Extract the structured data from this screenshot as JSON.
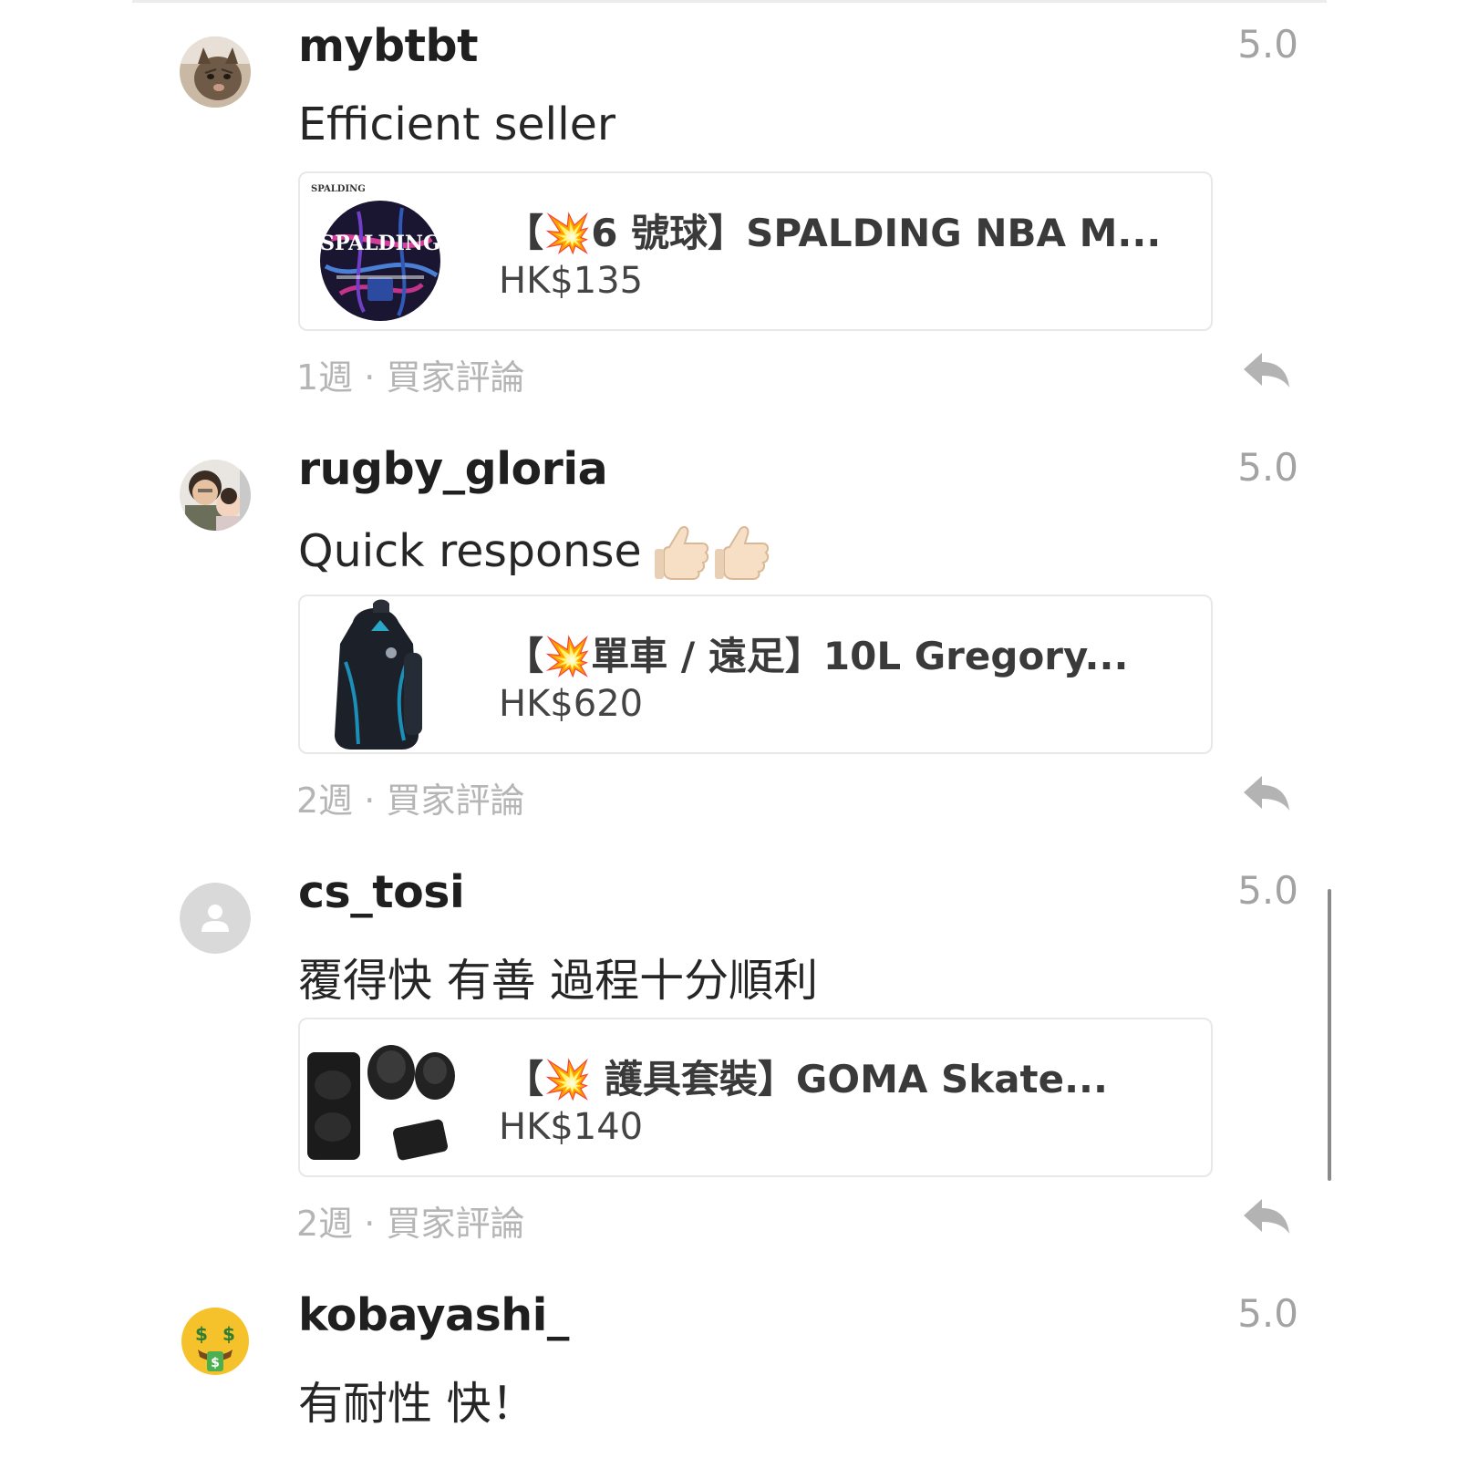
{
  "reviews": [
    {
      "username": "mybtbt",
      "rating": "5.0",
      "comment": "Efficient seller",
      "product_title": "【💥6 號球】SPALDING NBA M...",
      "product_price": "HK$135",
      "time": "1週",
      "separator": "·",
      "review_type": "買家評論",
      "avatar_icon": "cat-photo-avatar",
      "product_icon": "spalding-basketball-image",
      "product_image_text": "SPALDING",
      "product_image_brand_small": "SPALDING"
    },
    {
      "username": "rugby_gloria",
      "rating": "5.0",
      "comment": "Quick response",
      "comment_emoji": "👍🏻👍🏻",
      "product_title": "【💥單車 / 遠足】10L Gregory...",
      "product_price": "HK$620",
      "time": "2週",
      "separator": "·",
      "review_type": "買家評論",
      "avatar_icon": "person-photo-avatar",
      "product_icon": "backpack-image"
    },
    {
      "username": "cs_tosi",
      "rating": "5.0",
      "comment": "覆得快 有善 過程十分順利",
      "product_title": "【💥 護具套裝】GOMA Skate...",
      "product_price": "HK$140",
      "time": "2週",
      "separator": "·",
      "review_type": "買家評論",
      "avatar_icon": "default-user-avatar",
      "product_icon": "protective-gear-image"
    },
    {
      "username": "kobayashi_",
      "rating": "5.0",
      "comment": "有耐性 快！",
      "avatar_icon": "money-mouth-face-emoji-avatar"
    }
  ],
  "colors": {
    "username": "#1f1f1f",
    "rating": "#a3a3a3",
    "meta": "#b5b5b5",
    "card_border": "#e8e8e8"
  }
}
